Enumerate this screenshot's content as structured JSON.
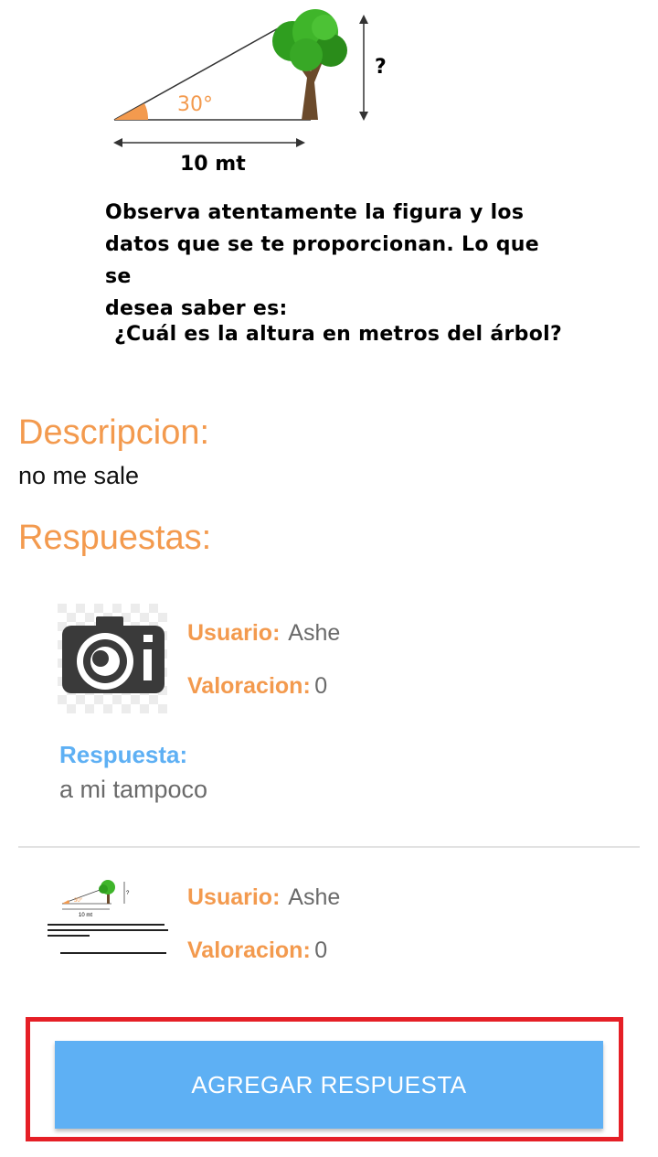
{
  "problem": {
    "angle_label": "30°",
    "unknown_label": "?",
    "base_label": "10 mt",
    "prompt_lines": [
      "Observa atentamente la figura y los",
      "datos que se te proporcionan. Lo que se",
      "desea saber es:"
    ],
    "question": "¿Cuál es la altura en metros del árbol?"
  },
  "description": {
    "heading": "Descripcion:",
    "text": "no me sale"
  },
  "answers": {
    "heading": "Respuestas:",
    "items": [
      {
        "user_label": "Usuario:",
        "user": "Ashe",
        "rating_label": "Valoracion:",
        "rating": "0",
        "answer_label": "Respuesta:",
        "answer": "a mi tampoco",
        "thumb_icon": "camera-icon"
      },
      {
        "user_label": "Usuario:",
        "user": "Ashe",
        "rating_label": "Valoracion:",
        "rating": "0",
        "thumb_icon": "problem-thumbnail"
      }
    ]
  },
  "actions": {
    "add_answer": "AGREGAR RESPUESTA"
  },
  "colors": {
    "accent_orange": "#f39a4e",
    "accent_blue": "#5eb0f4",
    "highlight_red": "#e51f26"
  }
}
